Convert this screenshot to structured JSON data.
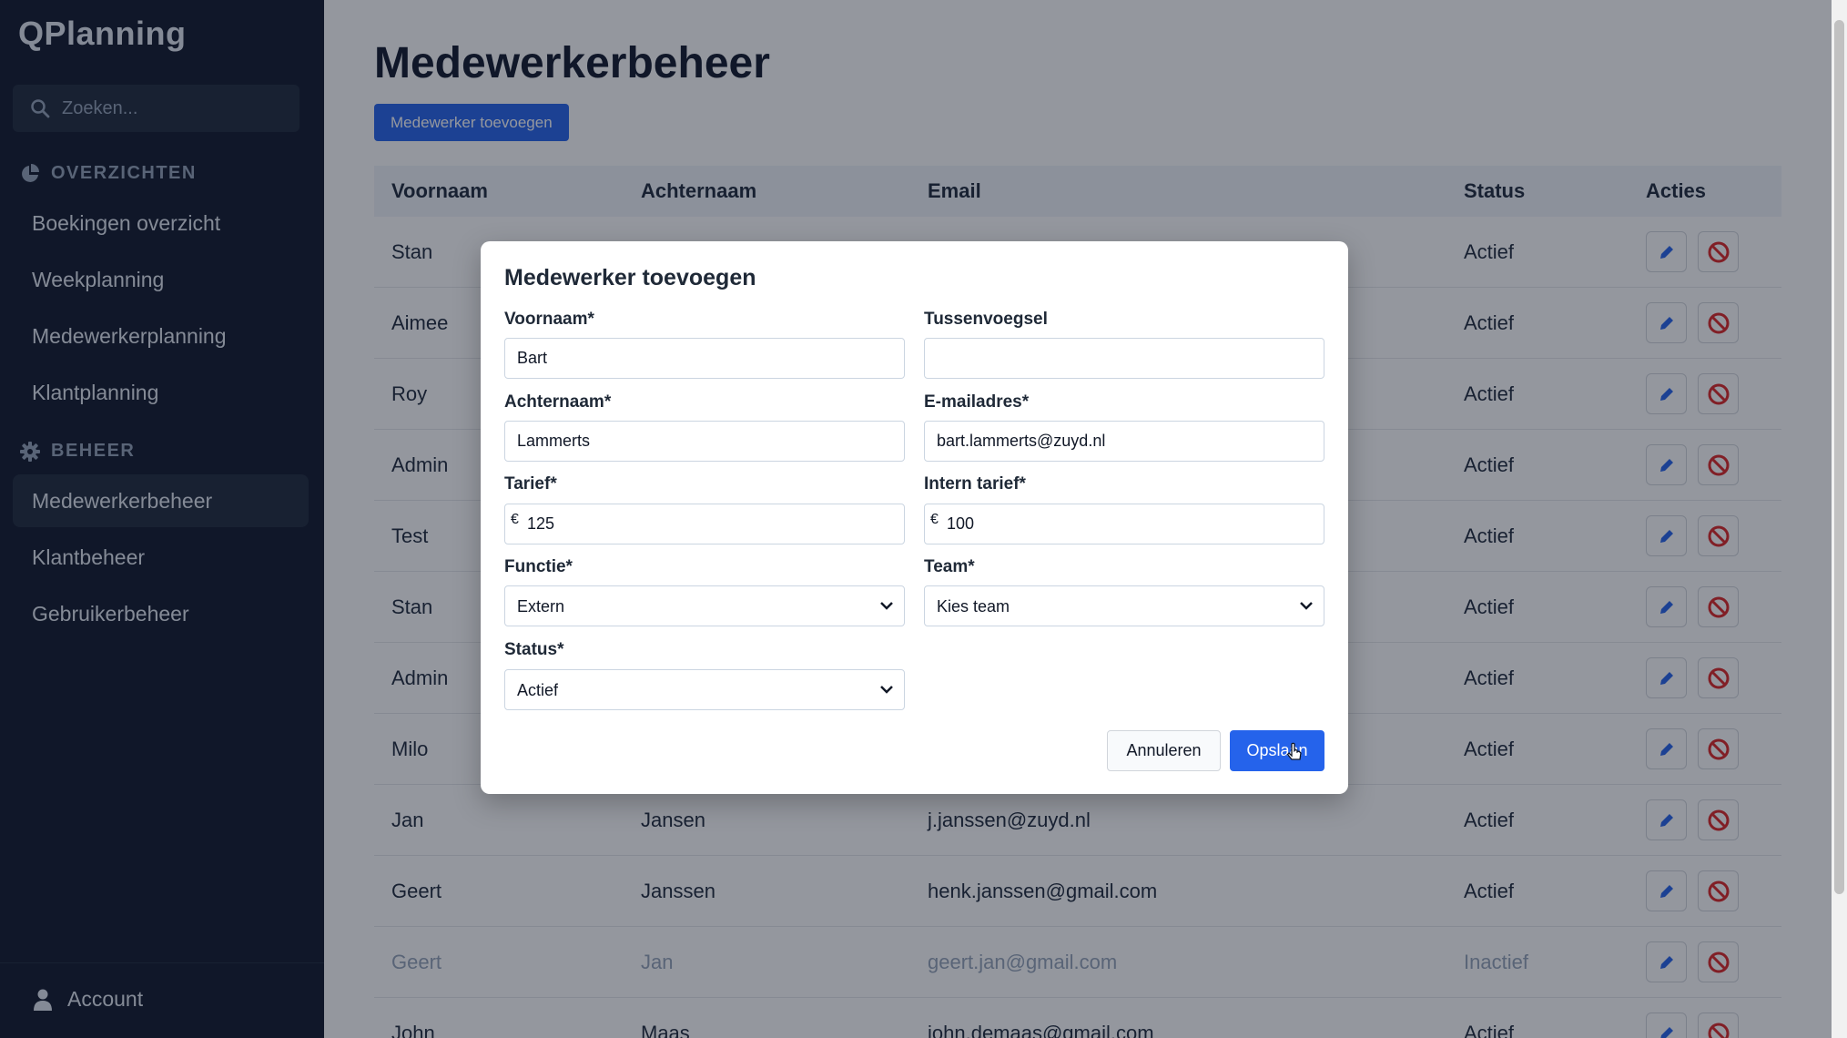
{
  "sidebar": {
    "brand": "QPlanning",
    "search_placeholder": "Zoeken...",
    "sections": [
      {
        "title": "OVERZICHTEN",
        "icon": "pie-chart-icon"
      },
      {
        "title": "BEHEER",
        "icon": "gear-icon"
      }
    ],
    "items": [
      {
        "label": "Boekingen overzicht"
      },
      {
        "label": "Weekplanning"
      },
      {
        "label": "Medewerkerplanning"
      },
      {
        "label": "Klantplanning"
      },
      {
        "label": "Medewerkerbeheer",
        "active": true
      },
      {
        "label": "Klantbeheer"
      },
      {
        "label": "Gebruikerbeheer"
      }
    ],
    "account": "Account"
  },
  "main": {
    "title": "Medewerkerbeheer",
    "add_button": "Medewerker toevoegen",
    "columns": [
      "Voornaam",
      "Achternaam",
      "Email",
      "Status",
      "Acties"
    ],
    "rows": [
      {
        "voornaam": "Stan",
        "achternaam": "",
        "email": "",
        "status": "Actief"
      },
      {
        "voornaam": "Aimee",
        "achternaam": "",
        "email": "",
        "status": "Actief"
      },
      {
        "voornaam": "Roy",
        "achternaam": "",
        "email": "",
        "status": "Actief"
      },
      {
        "voornaam": "Admin",
        "achternaam": "",
        "email": "",
        "status": "Actief"
      },
      {
        "voornaam": "Test",
        "achternaam": "",
        "email": "",
        "status": "Actief"
      },
      {
        "voornaam": "Stan",
        "achternaam": "",
        "email": "",
        "status": "Actief"
      },
      {
        "voornaam": "Admin",
        "achternaam": "",
        "email": "",
        "status": "Actief"
      },
      {
        "voornaam": "Milo",
        "achternaam": "",
        "email": "",
        "status": "Actief"
      },
      {
        "voornaam": "Jan",
        "achternaam": "Jansen",
        "email": "j.janssen@zuyd.nl",
        "status": "Actief"
      },
      {
        "voornaam": "Geert",
        "achternaam": "Janssen",
        "email": "henk.janssen@gmail.com",
        "status": "Actief"
      },
      {
        "voornaam": "Geert",
        "achternaam": "Jan",
        "email": "geert.jan@gmail.com",
        "status": "Inactief"
      },
      {
        "voornaam": "John",
        "achternaam": "Maas",
        "email": "john.demaas@gmail.com",
        "status": "Actief"
      }
    ]
  },
  "modal": {
    "title": "Medewerker toevoegen",
    "voornaam_label": "Voornaam*",
    "voornaam_value": "Bart",
    "tussenvoegsel_label": "Tussenvoegsel",
    "tussenvoegsel_value": "",
    "achternaam_label": "Achternaam*",
    "achternaam_value": "Lammerts",
    "email_label": "E-mailadres*",
    "email_value": "bart.lammerts@zuyd.nl",
    "tarief_label": "Tarief*",
    "tarief_value": "125",
    "intern_tarief_label": "Intern tarief*",
    "intern_tarief_value": "100",
    "currency": "€",
    "functie_label": "Functie*",
    "functie_value": "Extern",
    "team_label": "Team*",
    "team_value": "Kies team",
    "status_label": "Status*",
    "status_value": "Actief",
    "cancel_label": "Annuleren",
    "save_label": "Opslaan"
  },
  "colors": {
    "sidebar_bg": "#0f172a",
    "primary": "#2563eb",
    "edit_icon": "#2563eb",
    "deactivate_icon": "#dc2626"
  }
}
